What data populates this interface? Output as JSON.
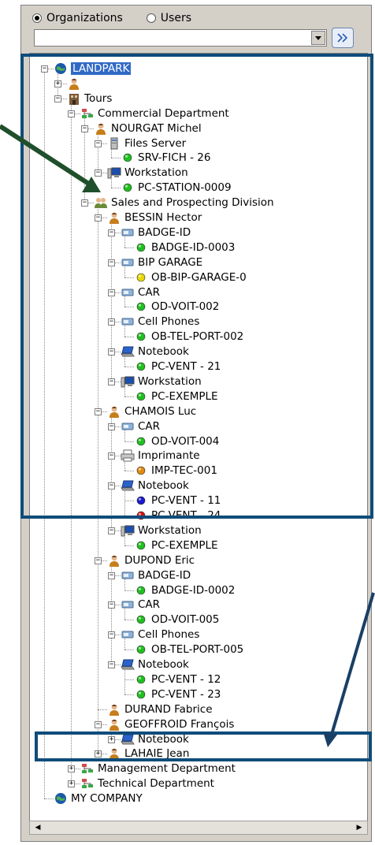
{
  "header": {
    "radio_organizations": "Organizations",
    "radio_users": "Users",
    "selected": "Organizations",
    "combo_value": ""
  },
  "tree": {
    "nodes": [
      {
        "label": "LANDPARK",
        "level": 0,
        "icon": "globe-icon",
        "exp": "-",
        "selected": true
      },
      {
        "label": "",
        "level": 1,
        "icon": "user-icon",
        "exp": "+"
      },
      {
        "label": "Tours",
        "level": 1,
        "icon": "building-icon",
        "exp": "-"
      },
      {
        "label": "Commercial Department",
        "level": 2,
        "icon": "department-icon",
        "exp": "-"
      },
      {
        "label": "NOURGAT Michel",
        "level": 3,
        "icon": "user-icon",
        "exp": "-"
      },
      {
        "label": "Files Server",
        "level": 4,
        "icon": "server-icon",
        "exp": "-"
      },
      {
        "label": "SRV-FICH - 26",
        "level": 5,
        "icon": "status-dot-green"
      },
      {
        "label": "Workstation",
        "level": 4,
        "icon": "workstation-icon",
        "exp": "-"
      },
      {
        "label": "PC-STATION-0009",
        "level": 5,
        "icon": "status-dot-green"
      },
      {
        "label": "Sales and Prospecting Division",
        "level": 3,
        "icon": "group-icon",
        "exp": "-"
      },
      {
        "label": "BESSIN Hector",
        "level": 4,
        "icon": "user-icon",
        "exp": "-"
      },
      {
        "label": "BADGE-ID",
        "level": 5,
        "icon": "device-icon",
        "exp": "-"
      },
      {
        "label": "BADGE-ID-0003",
        "level": 6,
        "icon": "status-dot-green"
      },
      {
        "label": "BIP GARAGE",
        "level": 5,
        "icon": "device-icon",
        "exp": "-"
      },
      {
        "label": "OB-BIP-GARAGE-0",
        "level": 6,
        "icon": "status-dot-yellow"
      },
      {
        "label": "CAR",
        "level": 5,
        "icon": "device-icon",
        "exp": "-"
      },
      {
        "label": "OD-VOIT-002",
        "level": 6,
        "icon": "status-dot-green"
      },
      {
        "label": "Cell Phones",
        "level": 5,
        "icon": "device-icon",
        "exp": "-"
      },
      {
        "label": "OB-TEL-PORT-002",
        "level": 6,
        "icon": "status-dot-green"
      },
      {
        "label": "Notebook",
        "level": 5,
        "icon": "notebook-icon",
        "exp": "-"
      },
      {
        "label": "PC-VENT - 21",
        "level": 6,
        "icon": "status-dot-green"
      },
      {
        "label": "Workstation",
        "level": 5,
        "icon": "workstation-icon",
        "exp": "-"
      },
      {
        "label": "PC-EXEMPLE",
        "level": 6,
        "icon": "status-dot-green"
      },
      {
        "label": "CHAMOIS Luc",
        "level": 4,
        "icon": "user-icon",
        "exp": "-"
      },
      {
        "label": "CAR",
        "level": 5,
        "icon": "device-icon",
        "exp": "-"
      },
      {
        "label": "OD-VOIT-004",
        "level": 6,
        "icon": "status-dot-green"
      },
      {
        "label": "Imprimante",
        "level": 5,
        "icon": "printer-icon",
        "exp": "-"
      },
      {
        "label": "IMP-TEC-001",
        "level": 6,
        "icon": "status-dot-orange"
      },
      {
        "label": "Notebook",
        "level": 5,
        "icon": "notebook-icon",
        "exp": "-"
      },
      {
        "label": "PC-VENT - 11",
        "level": 6,
        "icon": "status-dot-blue"
      },
      {
        "label": "PC-VENT - 24",
        "level": 6,
        "icon": "status-dot-red"
      },
      {
        "label": "Workstation",
        "level": 5,
        "icon": "workstation-icon",
        "exp": "-"
      },
      {
        "label": "PC-EXEMPLE",
        "level": 6,
        "icon": "status-dot-green"
      },
      {
        "label": "DUPOND Eric",
        "level": 4,
        "icon": "user-icon",
        "exp": "-"
      },
      {
        "label": "BADGE-ID",
        "level": 5,
        "icon": "device-icon",
        "exp": "-"
      },
      {
        "label": "BADGE-ID-0002",
        "level": 6,
        "icon": "status-dot-green"
      },
      {
        "label": "CAR",
        "level": 5,
        "icon": "device-icon",
        "exp": "-"
      },
      {
        "label": "OD-VOIT-005",
        "level": 6,
        "icon": "status-dot-green"
      },
      {
        "label": "Cell Phones",
        "level": 5,
        "icon": "device-icon",
        "exp": "-"
      },
      {
        "label": "OB-TEL-PORT-005",
        "level": 6,
        "icon": "status-dot-green"
      },
      {
        "label": "Notebook",
        "level": 5,
        "icon": "notebook-icon",
        "exp": "-"
      },
      {
        "label": "PC-VENT - 12",
        "level": 6,
        "icon": "status-dot-green"
      },
      {
        "label": "PC-VENT - 23",
        "level": 6,
        "icon": "status-dot-green"
      },
      {
        "label": "DURAND Fabrice",
        "level": 4,
        "icon": "user-icon"
      },
      {
        "label": "GEOFFROID François",
        "level": 4,
        "icon": "user-icon",
        "exp": "-"
      },
      {
        "label": "Notebook",
        "level": 5,
        "icon": "notebook-icon",
        "exp": "+"
      },
      {
        "label": "LAHAIE Jean",
        "level": 4,
        "icon": "user-icon",
        "exp": "+"
      },
      {
        "label": "Management Department",
        "level": 2,
        "icon": "department-icon",
        "exp": "+"
      },
      {
        "label": "Technical Department",
        "level": 2,
        "icon": "department-icon",
        "exp": "+"
      },
      {
        "label": "MY COMPANY",
        "level": 0,
        "icon": "globe-icon"
      }
    ]
  },
  "colors": {
    "selection": "#316ac5",
    "highlight_box": "#0f4c7a",
    "arrow": "#1f4f2b",
    "status_green": "#1fbf1f",
    "status_yellow": "#e8d800",
    "status_orange": "#e08a10",
    "status_blue": "#1a1ad0",
    "status_red": "#d81010"
  }
}
